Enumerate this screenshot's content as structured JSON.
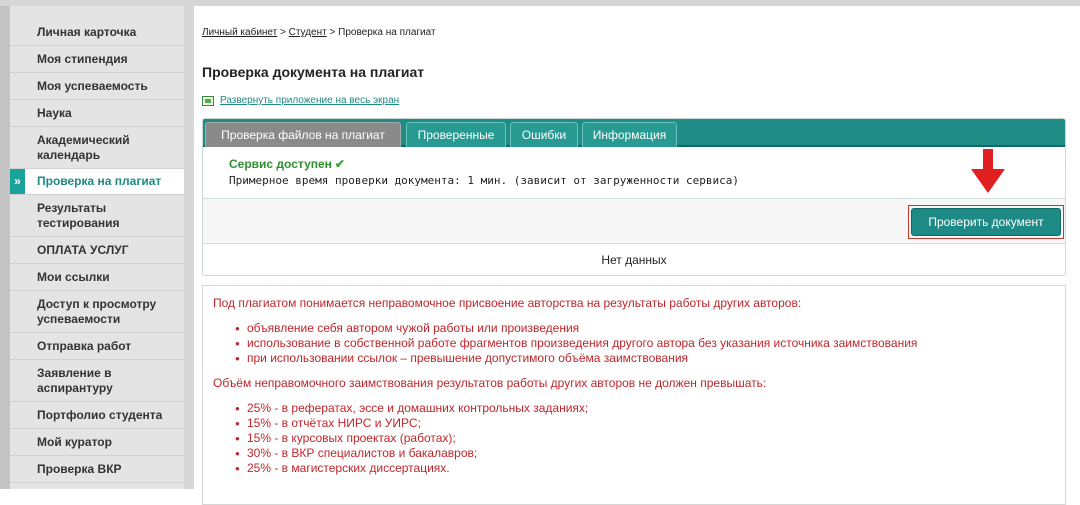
{
  "sidebar": {
    "items": [
      {
        "label": "Личная карточка",
        "active": false
      },
      {
        "label": "Моя стипендия",
        "active": false
      },
      {
        "label": "Моя успеваемость",
        "active": false
      },
      {
        "label": "Наука",
        "active": false
      },
      {
        "label": "Академический календарь",
        "active": false
      },
      {
        "label": "Проверка на плагиат",
        "active": true
      },
      {
        "label": "Результаты тестирования",
        "active": false
      },
      {
        "label": "ОПЛАТА УСЛУГ",
        "active": false
      },
      {
        "label": "Мои ссылки",
        "active": false
      },
      {
        "label": "Доступ к просмотру успеваемости",
        "active": false
      },
      {
        "label": "Отправка работ",
        "active": false
      },
      {
        "label": "Заявление в аспирантуру",
        "active": false
      },
      {
        "label": "Портфолио студента",
        "active": false
      },
      {
        "label": "Мой куратор",
        "active": false
      },
      {
        "label": "Проверка ВКР",
        "active": false
      }
    ],
    "active_marker": "»"
  },
  "breadcrumb": {
    "link1": "Личный кабинет",
    "sep": ">",
    "link2": "Студент",
    "current": "Проверка на плагиат"
  },
  "page_title": "Проверка документа на плагиат",
  "expand_link": "Развернуть приложение на весь экран",
  "tabs": [
    {
      "label": "Проверка файлов на плагиат",
      "active": true
    },
    {
      "label": "Проверенные",
      "active": false
    },
    {
      "label": "Ошибки",
      "active": false
    },
    {
      "label": "Информация",
      "active": false
    }
  ],
  "status": {
    "title": "Сервис доступен",
    "check_glyph": "✔",
    "message": "Примерное время проверки документа: 1 мин. (зависит от загруженности сервиса)"
  },
  "check_button": "Проверить документ",
  "no_data": "Нет данных",
  "info": {
    "intro": "Под плагиатом понимается неправомочное присвоение авторства на результаты работы других авторов:",
    "items1": [
      "объявление себя автором чужой работы или произведения",
      "использование в собственной работе фрагментов произведения другого автора без указания источника заимствования",
      "при использовании ссылок – превышение допустимого объёма заимствования"
    ],
    "limit_intro": "Объём неправомочного заимствования результатов работы других авторов не должен превышать:",
    "items2": [
      "25% - в рефератах, эссе и домашних контрольных заданиях;",
      "15% - в отчётах НИРС и УИРС;",
      "15% - в курсовых проектах (работах);",
      "30% - в ВКР специалистов и бакалавров;",
      "25% - в магистерских диссертациях."
    ]
  },
  "colors": {
    "accent": "#1e8a86",
    "warning_text": "#c0262b",
    "status_ok": "#2f8f2f",
    "arrow": "#e02020"
  }
}
